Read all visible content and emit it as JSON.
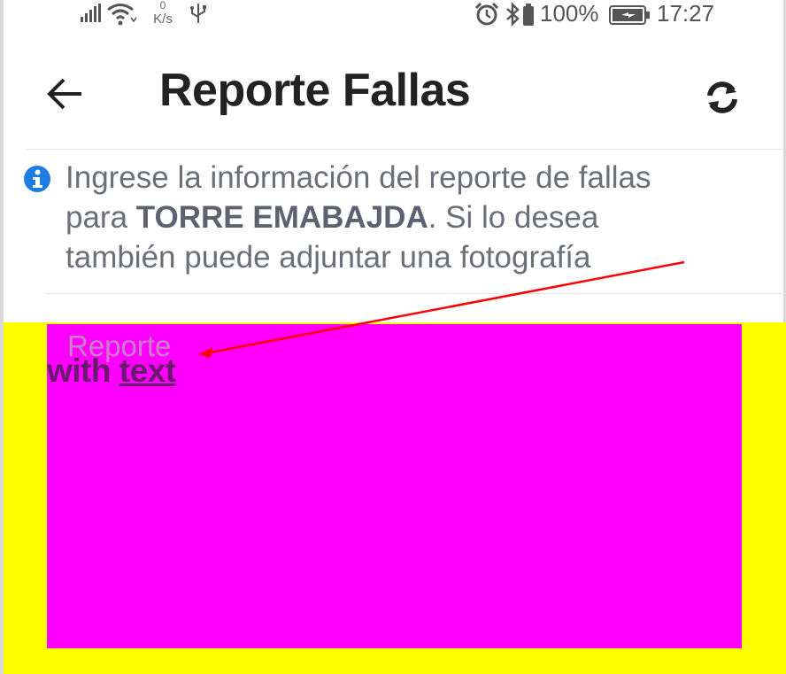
{
  "status_bar": {
    "speed_value": "0",
    "speed_unit": "K/s",
    "battery_percent": "100%",
    "time": "17:27"
  },
  "header": {
    "title": "Reporte Fallas"
  },
  "info": {
    "line1": "Ingrese la información del reporte de fallas",
    "line2_prefix": "para ",
    "place_name": "TORRE EMABAJDA",
    "line2_suffix": ". Si lo desea",
    "line3": "también puede adjuntar una fotografía"
  },
  "form": {
    "report_label": "Reporte",
    "overlay_word1": "with",
    "overlay_word2": "text"
  },
  "colors": {
    "annotation_yellow": "#ffff00",
    "annotation_magenta": "#ff00ff",
    "info_blue": "#1e7de0",
    "arrow_red": "#ff0000"
  }
}
